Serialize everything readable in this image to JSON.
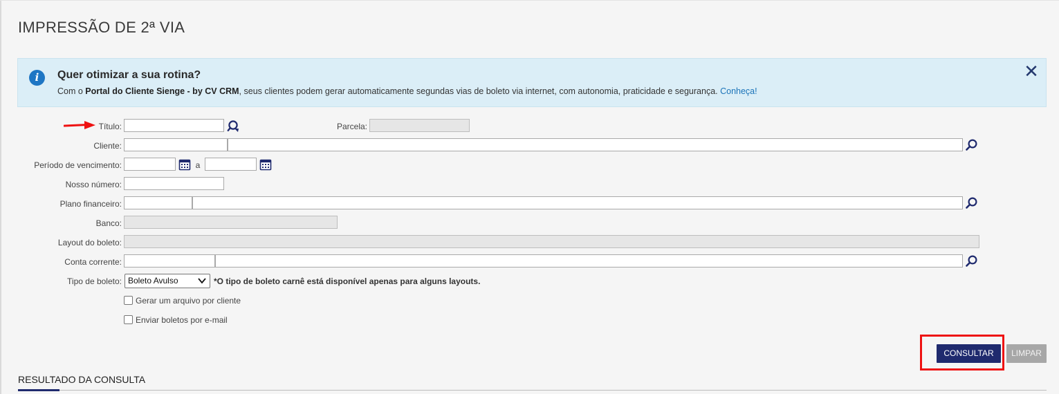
{
  "page": {
    "title": "IMPRESSÃO DE 2ª VIA"
  },
  "banner": {
    "title": "Quer otimizar a sua rotina?",
    "text_prefix": "Com o ",
    "text_bold": "Portal do Cliente Sienge - by CV CRM",
    "text_middle": ", seus clientes podem gerar automaticamente segundas vias de boleto via internet, com autonomia, praticidade e segurança. ",
    "link": "Conheça!",
    "icon": "info-icon",
    "close_icon": "close-icon",
    "close_symbol": "✕"
  },
  "form": {
    "titulo_label": "Título:",
    "titulo_value": "",
    "parcela_label": "Parcela:",
    "parcela_value": "",
    "cliente_label": "Cliente:",
    "cliente_code": "",
    "cliente_name": "",
    "periodo_label": "Período de vencimento:",
    "periodo_from": "",
    "periodo_sep": "a",
    "periodo_to": "",
    "nosso_numero_label": "Nosso número:",
    "nosso_numero_value": "",
    "plano_label": "Plano financeiro:",
    "plano_code": "",
    "plano_name": "",
    "banco_label": "Banco:",
    "banco_value": "",
    "layout_label": "Layout do boleto:",
    "layout_value": "",
    "conta_label": "Conta corrente:",
    "conta_code": "",
    "conta_name": "",
    "tipo_label": "Tipo de boleto:",
    "tipo_selected": "Boleto Avulso",
    "tipo_note": "*O tipo de boleto carnê está disponível apenas para alguns layouts.",
    "gerar_label": "Gerar um arquivo por cliente",
    "enviar_label": "Enviar boletos por e-mail"
  },
  "actions": {
    "consultar": "CONSULTAR",
    "limpar": "LIMPAR"
  },
  "result": {
    "title": "RESULTADO DA CONSULTA"
  },
  "colors": {
    "primary": "#1f2a6e",
    "banner_bg": "#dbeef7",
    "link": "#1a73b8",
    "highlight": "#ee1111"
  }
}
